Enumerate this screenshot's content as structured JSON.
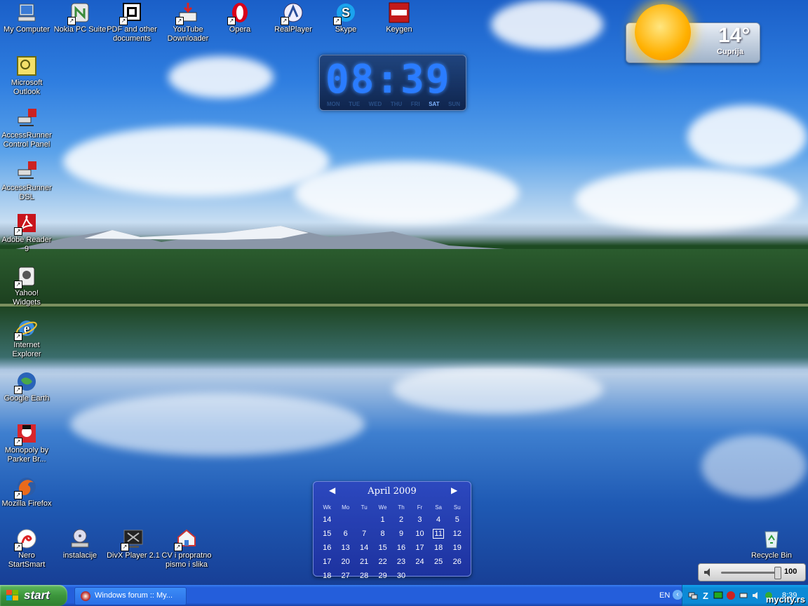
{
  "desktop": {
    "icons": [
      {
        "label": "My Computer"
      },
      {
        "label": "Nokia PC Suite"
      },
      {
        "label": "PDF and other documents"
      },
      {
        "label": "YouTube Downloader"
      },
      {
        "label": "Opera"
      },
      {
        "label": "RealPlayer"
      },
      {
        "label": "Skype"
      },
      {
        "label": "Keygen"
      },
      {
        "label": "Microsoft Outlook"
      },
      {
        "label": "AccessRunner Control Panel"
      },
      {
        "label": "AccessRunner DSL"
      },
      {
        "label": "Adobe Reader 9"
      },
      {
        "label": "Yahoo! Widgets"
      },
      {
        "label": "Internet Explorer"
      },
      {
        "label": "Google Earth"
      },
      {
        "label": "Monopoly by Parker Br..."
      },
      {
        "label": "Mozilla Firefox"
      },
      {
        "label": "Nero StartSmart"
      },
      {
        "label": "instalacije"
      },
      {
        "label": "DivX Player 2.1"
      },
      {
        "label": "CV i propratno pismo i slika"
      },
      {
        "label": "Recycle Bin"
      }
    ]
  },
  "clock_widget": {
    "time": "08:39",
    "days": [
      "MON",
      "TUE",
      "WED",
      "THU",
      "FRI",
      "SAT",
      "SUN"
    ],
    "active_day": "SAT"
  },
  "weather_widget": {
    "temperature": "14°",
    "city": "Cuprija"
  },
  "calendar_widget": {
    "month_label": "April 2009",
    "prev": "◀",
    "next": "▶",
    "headers": [
      "Wk",
      "Mo",
      "Tu",
      "We",
      "Th",
      "Fr",
      "Sa",
      "Su"
    ],
    "rows": [
      [
        "14",
        "",
        "",
        "1",
        "2",
        "3",
        "4",
        "5"
      ],
      [
        "15",
        "6",
        "7",
        "8",
        "9",
        "10",
        "11",
        "12"
      ],
      [
        "16",
        "13",
        "14",
        "15",
        "16",
        "17",
        "18",
        "19"
      ],
      [
        "17",
        "20",
        "21",
        "22",
        "23",
        "24",
        "25",
        "26"
      ],
      [
        "18",
        "27",
        "28",
        "29",
        "30",
        "",
        "",
        ""
      ]
    ],
    "today": "11"
  },
  "volume_widget": {
    "value": "100",
    "level": 1.0
  },
  "taskbar": {
    "start_label": "start",
    "task_item_label": "Windows forum :: My...",
    "language": "EN",
    "clock": "8:39"
  },
  "watermark": "mycity.rs",
  "colors": {
    "taskbar": "#245edb",
    "start_button": "#3c963c",
    "tray": "#0c8ad6",
    "calendar_bg": "#2d46be"
  }
}
